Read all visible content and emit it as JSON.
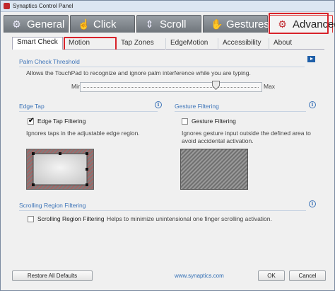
{
  "window": {
    "title": "Synaptics Control Panel"
  },
  "main_tabs": [
    {
      "label": "General",
      "icon": "gear-outline-icon"
    },
    {
      "label": "Click",
      "icon": "click-hand-icon"
    },
    {
      "label": "Scroll",
      "icon": "scroll-arrows-icon"
    },
    {
      "label": "Gestures",
      "icon": "gestures-icon"
    },
    {
      "label": "Advanced",
      "icon": "gear-icon",
      "active": true
    }
  ],
  "sub_tabs": [
    {
      "label": "Smart Check",
      "active": true
    },
    {
      "label": "Motion"
    },
    {
      "label": "Tap Zones"
    },
    {
      "label": "EdgeMotion"
    },
    {
      "label": "Accessibility"
    },
    {
      "label": "About"
    }
  ],
  "palm_check": {
    "title": "Palm Check Threshold",
    "description": "Allows the TouchPad to recognize and ignore palm interference while you are typing.",
    "min_label": "Min",
    "max_label": "Max",
    "level": 0.76
  },
  "edge_tap": {
    "title": "Edge Tap",
    "checkbox_label": "Edge Tap Filtering",
    "checked": true,
    "description": "Ignores taps in the adjustable edge region."
  },
  "gesture_filtering": {
    "title": "Gesture Filtering",
    "checkbox_label": "Gesture Filtering",
    "checked": false,
    "description": "Ignores gesture input outside the defined area to avoid accidental activation."
  },
  "scrolling_region": {
    "title": "Scrolling Region Filtering",
    "checkbox_label": "Scrolling Region Filtering",
    "checked": false,
    "description": "Helps to minimize unintensional one finger scrolling activation."
  },
  "footer": {
    "restore_label": "Restore All Defaults",
    "link_text": "www.synaptics.com",
    "ok_label": "OK",
    "cancel_label": "Cancel"
  },
  "colors": {
    "accent": "#3d74b8",
    "highlight_box": "#d8222a",
    "brand": "#c0282d"
  }
}
